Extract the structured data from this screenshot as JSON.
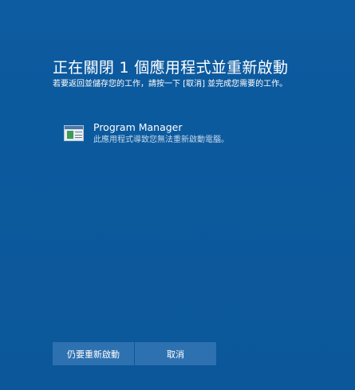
{
  "dialog": {
    "title": "正在關閉 1 個應用程式並重新啟動",
    "subtitle": "若要返回並儲存您的工作，請按一下 [取消] 並完成您需要的工作。"
  },
  "apps": [
    {
      "name": "Program Manager",
      "description": "此應用程式導致您無法重新啟動電腦。",
      "icon": "program-manager-icon"
    }
  ],
  "buttons": {
    "restart_label": "仍要重新啟動",
    "cancel_label": "取消"
  },
  "colors": {
    "background": "#0c5a9e",
    "button": "#2e71b0",
    "description_text": "#c4d8ec"
  }
}
